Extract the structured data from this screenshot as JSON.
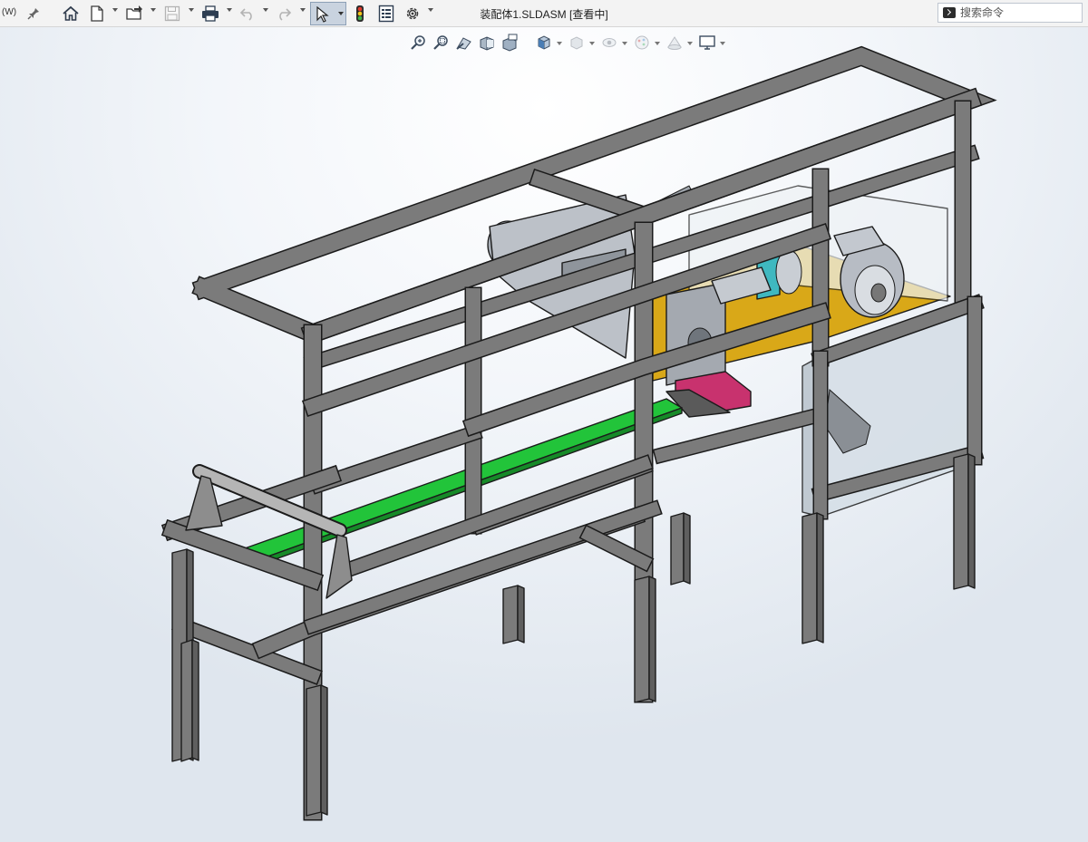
{
  "window": {
    "menu_tag": "(W)",
    "title": "装配体1.SLDASM [查看中]"
  },
  "toolbar": {
    "items": [
      {
        "icon": "pin-icon"
      },
      {
        "icon": "home-icon"
      },
      {
        "icon": "new-document-icon"
      },
      {
        "icon": "open-folder-icon"
      },
      {
        "icon": "save-icon"
      },
      {
        "icon": "print-icon"
      },
      {
        "icon": "undo-icon"
      },
      {
        "icon": "redo-icon"
      },
      {
        "icon": "select-arrow-icon"
      },
      {
        "icon": "rebuild-traffic-light-icon"
      },
      {
        "icon": "file-properties-icon"
      },
      {
        "icon": "options-gear-icon"
      }
    ]
  },
  "search": {
    "placeholder": "搜索命令",
    "value": ""
  },
  "heads_up_toolbar": {
    "items": [
      {
        "icon": "zoom-to-fit-icon"
      },
      {
        "icon": "zoom-to-area-icon"
      },
      {
        "icon": "previous-view-icon"
      },
      {
        "icon": "section-view-icon"
      },
      {
        "icon": "dynamic-annotation-icon"
      },
      {
        "icon": "view-orientation-icon"
      },
      {
        "icon": "display-style-icon"
      },
      {
        "icon": "hide-show-items-icon"
      },
      {
        "icon": "edit-appearance-icon"
      },
      {
        "icon": "apply-scene-icon"
      },
      {
        "icon": "view-settings-icon"
      }
    ]
  },
  "colors": {
    "frame_face": "#7b7b7b",
    "frame_top": "#9a9a9a",
    "frame_edge": "#1b1b1b",
    "belt_green": "#22c43a",
    "slide_pink": "#c8326e",
    "plate_yellow": "#d9a818",
    "guard_glass": "#d5dee6",
    "motor_gray": "#b7bcc4",
    "accent_cyan": "#3fb8c0"
  }
}
